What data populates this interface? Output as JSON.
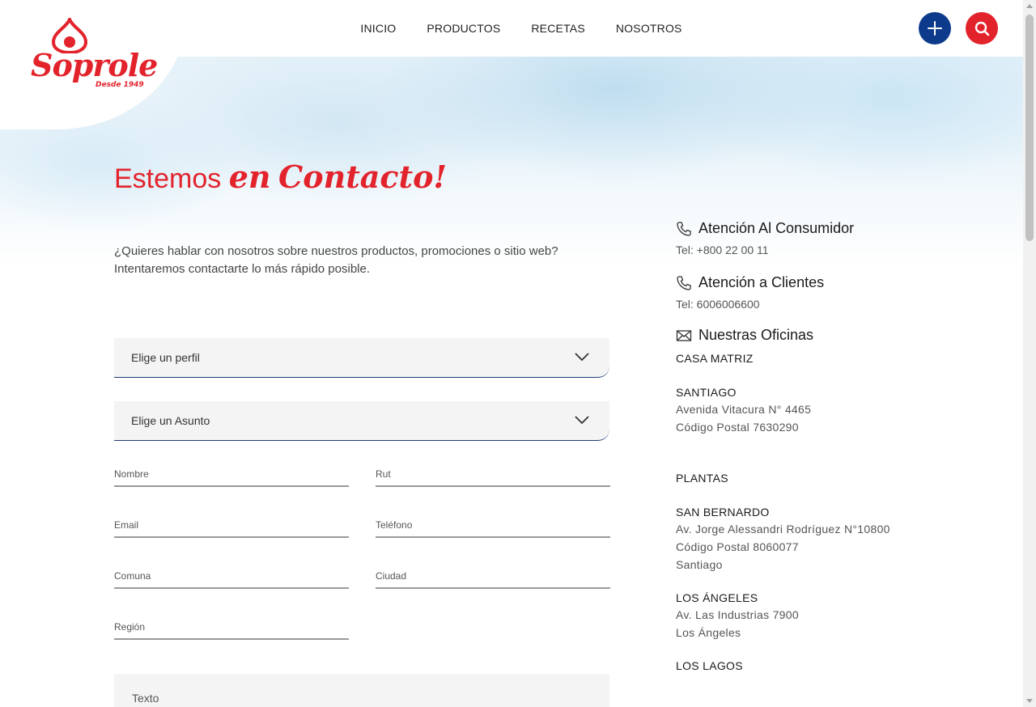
{
  "brand": {
    "logo_text": "Soprole",
    "logo_tagline": "Desde 1949",
    "primary_color": "#e3232c",
    "secondary_color": "#0e3a8c"
  },
  "nav": {
    "items": [
      {
        "label": "INICIO"
      },
      {
        "label": "PRODUCTOS"
      },
      {
        "label": "RECETAS"
      },
      {
        "label": "NOSOTROS"
      }
    ]
  },
  "header_actions": {
    "plus_icon": "plus-icon",
    "search_icon": "search-icon"
  },
  "page": {
    "title_part1": "Estemos",
    "title_part2": "en",
    "title_part3": "Contacto!",
    "intro_line1": "¿Quieres hablar con nosotros sobre nuestros productos, promociones o sitio web?",
    "intro_line2": "Intentaremos contactarte lo más rápido posible."
  },
  "form": {
    "profile_select": "Elige un perfil",
    "subject_select": "Elige un Asunto",
    "fields": {
      "nombre": "Nombre",
      "rut": "Rut",
      "email": "Email",
      "telefono": "Teléfono",
      "comuna": "Comuna",
      "ciudad": "Ciudad",
      "region": "Región",
      "texto": "Texto"
    }
  },
  "contact": {
    "consumer_heading": "Atención Al Consumidor",
    "consumer_phone": "Tel: +800 22 00 11",
    "clients_heading": "Atención a Clientes",
    "clients_phone": "Tel: 6006006600",
    "offices_heading": "Nuestras Oficinas",
    "casa_matriz": "CASA MATRIZ",
    "santiago_title": "SANTIAGO",
    "santiago_address": "Avenida Vitacura N° 4465",
    "santiago_postal": "Código Postal 7630290",
    "plantas": "PLANTAS",
    "san_bernardo_title": "SAN BERNARDO",
    "san_bernardo_address": "Av. Jorge Alessandri Rodríguez N°10800",
    "san_bernardo_postal": "Código Postal  8060077",
    "san_bernardo_city": "Santiago",
    "los_angeles_title": "LOS ÁNGELES",
    "los_angeles_address": "Av. Las Industrias 7900",
    "los_angeles_city": "Los Ángeles",
    "los_lagos_title": "LOS LAGOS"
  }
}
